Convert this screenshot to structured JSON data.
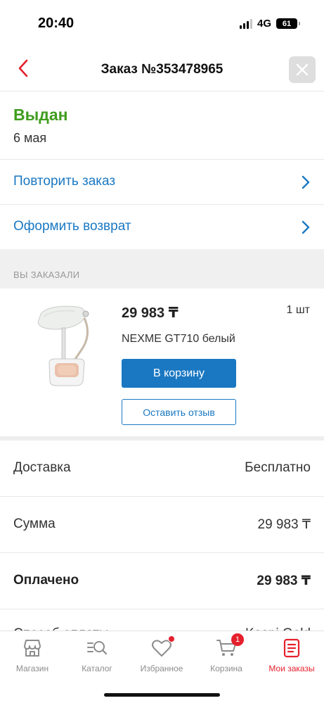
{
  "status_bar": {
    "time": "20:40",
    "network": "4G",
    "battery": "61"
  },
  "header": {
    "title": "Заказ №353478965",
    "back_icon": "chevron-left-icon",
    "close_icon": "close-icon"
  },
  "order": {
    "status": "Выдан",
    "date": "6 мая",
    "actions": [
      {
        "label": "Повторить заказ"
      },
      {
        "label": "Оформить возврат"
      }
    ]
  },
  "ordered_section": {
    "title": "ВЫ ЗАКАЗАЛИ",
    "item": {
      "price": "29 983 ₸",
      "quantity": "1 шт",
      "name": "NEXME GT710 белый",
      "cart_button": "В корзину",
      "review_button": "Оставить отзыв"
    }
  },
  "summary": [
    {
      "label": "Доставка",
      "value": "Бесплатно"
    },
    {
      "label": "Сумма",
      "value": "29 983 ₸"
    },
    {
      "label": "Оплачено",
      "value": "29 983 ₸"
    }
  ],
  "cut_row": {
    "label": "Способ оплаты",
    "value": "Kaspi Gold"
  },
  "bottom_nav": [
    {
      "label": "Магазин",
      "icon": "store-icon"
    },
    {
      "label": "Каталог",
      "icon": "catalog-search-icon"
    },
    {
      "label": "Избранное",
      "icon": "heart-icon"
    },
    {
      "label": "Корзина",
      "icon": "cart-icon",
      "badge": "1"
    },
    {
      "label": "Мои заказы",
      "icon": "orders-icon",
      "active": true
    }
  ],
  "colors": {
    "accent": "#1a78c2",
    "status": "#3f9d1e",
    "brand": "#e5202d"
  }
}
